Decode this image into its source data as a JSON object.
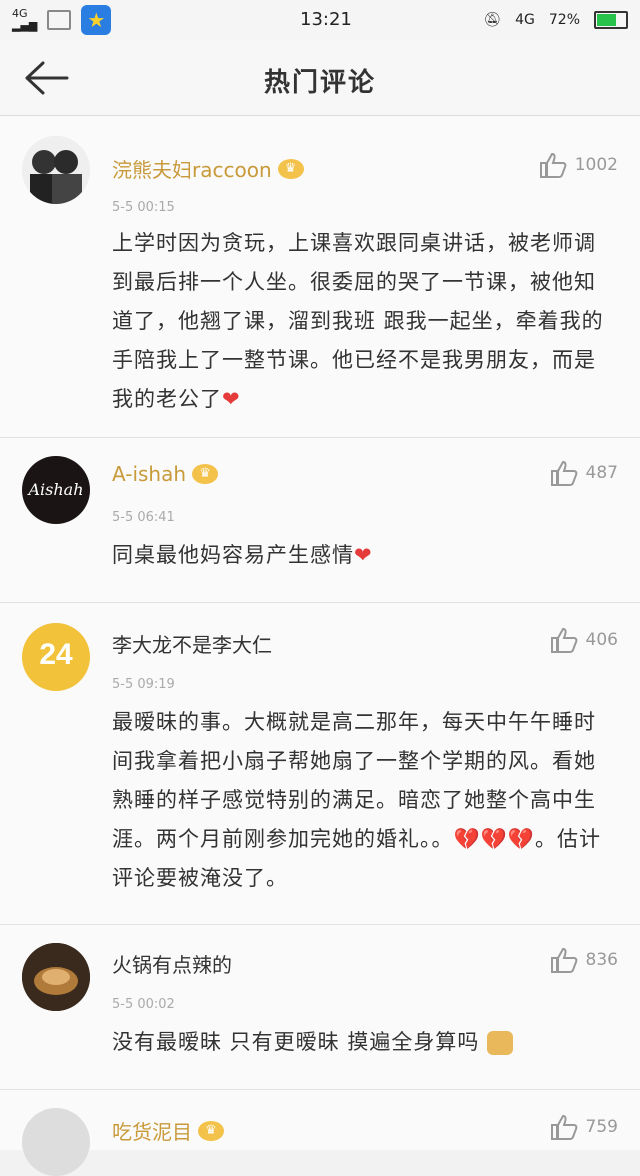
{
  "status": {
    "network_top": "4G",
    "network_bottom": "",
    "time": "13:21",
    "net2": "4G",
    "battery": "72%",
    "battery_level": 0.72
  },
  "header": {
    "title": "热门评论"
  },
  "comments": [
    {
      "user": "浣熊夫妇raccoon",
      "time": "5-5 00:15",
      "likes": "1002",
      "text": "上学时因为贪玩，上课喜欢跟同桌讲话，被老师调到最后排一个人坐。很委屈的哭了一节课，被他知道了，他翘了课，溜到我班 跟我一起坐，牵着我的手陪我上了一整节课。他已经不是我男朋友，而是我的老公了",
      "emoji": "❤"
    },
    {
      "user": "A-ishah",
      "avatar_text": "Aishah",
      "time": "5-5 06:41",
      "likes": "487",
      "text": "同桌最他妈容易产生感情",
      "emoji": "❤"
    },
    {
      "user": "李大龙不是李大仁",
      "avatar_text": "24",
      "time": "5-5 09:19",
      "likes": "406",
      "text": "最暧昧的事。大概就是高二那年，每天中午午睡时间我拿着把小扇子帮她扇了一整个学期的风。看她熟睡的样子感觉特别的满足。暗恋了她整个高中生涯。两个月前刚参加完她的婚礼。。",
      "emoji": "💔💔💔",
      "text_after": "。估计评论要被淹没了。"
    },
    {
      "user": "火锅有点辣的",
      "time": "5-5 00:02",
      "likes": "836",
      "text": "没有最暧昧 只有更暧昧  摸遍全身算吗"
    },
    {
      "user": "吃货泥目",
      "likes": "759"
    }
  ]
}
